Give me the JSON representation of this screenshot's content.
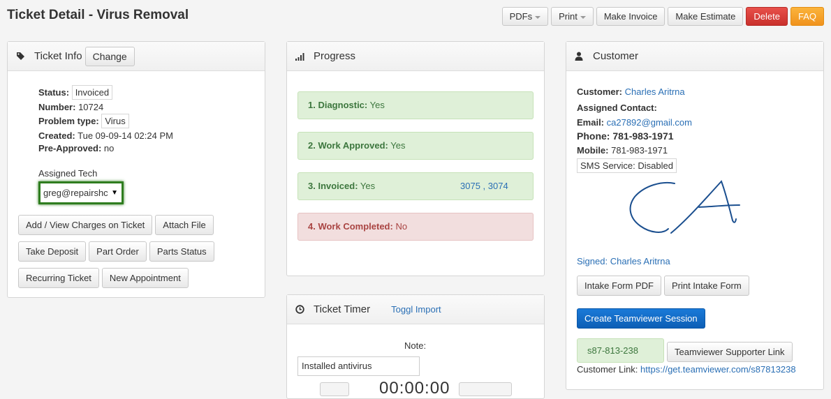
{
  "page": {
    "title": "Ticket Detail - Virus Removal"
  },
  "top_actions": {
    "pdfs": "PDFs",
    "print": "Print",
    "make_invoice": "Make Invoice",
    "make_estimate": "Make Estimate",
    "delete": "Delete",
    "faq": "FAQ"
  },
  "colors": {
    "delete": "#d9534f",
    "faq": "#f0ad4e",
    "primary": "#1a6fca",
    "success_bg": "#dff0d8",
    "danger_bg": "#f2dede",
    "link": "#2a6fb5"
  },
  "ticket_info": {
    "heading": "Ticket Info",
    "change_label": "Change",
    "icon": "tag-icon",
    "status_label": "Status:",
    "status_value": "Invoiced",
    "number_label": "Number:",
    "number_value": "10724",
    "problem_label": "Problem type:",
    "problem_value": "Virus",
    "created_label": "Created:",
    "created_value": "Tue 09-09-14 02:24 PM",
    "preapproved_label": "Pre-Approved:",
    "preapproved_value": "no",
    "assigned_tech_label": "Assigned Tech",
    "assigned_tech_value": "greg@repairshc",
    "buttons": {
      "add_charges": "Add / View Charges on Ticket",
      "attach_file": "Attach File",
      "take_deposit": "Take Deposit",
      "part_order": "Part Order",
      "parts_status": "Parts Status",
      "recurring_ticket": "Recurring Ticket",
      "new_appointment": "New Appointment"
    }
  },
  "progress": {
    "heading": "Progress",
    "icon": "signal-bars-icon",
    "items": [
      {
        "label": "1. Diagnostic:",
        "value": "Yes"
      },
      {
        "label": "2. Work Approved:",
        "value": "Yes"
      },
      {
        "label": "3. Invoiced:",
        "value": "Yes",
        "links": "3075 , 3074"
      },
      {
        "label": "4. Work Completed:",
        "value": "No"
      }
    ]
  },
  "timer": {
    "heading": "Ticket Timer",
    "icon": "clock-icon",
    "toggl_link": "Toggl Import",
    "note_label": "Note:",
    "note_value": "Installed antivirus",
    "time_display": "00:00:00"
  },
  "customer": {
    "heading": "Customer",
    "icon": "user-icon",
    "customer_label": "Customer:",
    "customer_name": "Charles Aritrna",
    "assigned_contact_label": "Assigned Contact:",
    "email_label": "Email:",
    "email_value": "ca27892@gmail.com",
    "phone_label": "Phone:",
    "phone_value": "781-983-1971",
    "mobile_label": "Mobile:",
    "mobile_value": "781-983-1971",
    "sms_status": "SMS Service: Disabled",
    "signed_link": "Signed: Charles Aritrna",
    "intake_pdf": "Intake Form PDF",
    "print_intake": "Print Intake Form",
    "teamviewer_session": "Create Teamviewer Session",
    "teamviewer_id": "s87-813-238",
    "teamviewer_supporter": "Teamviewer Supporter Link",
    "customer_link_label": "Customer Link:",
    "customer_link_url": "https://get.teamviewer.com/s87813238"
  }
}
